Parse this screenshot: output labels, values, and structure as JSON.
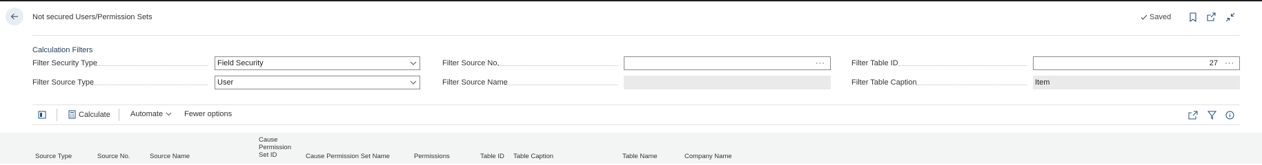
{
  "page": {
    "title": "Not secured Users/Permission Sets",
    "saved_label": "Saved"
  },
  "calculation_filters": {
    "section_title": "Calculation Filters",
    "filter_security_type": {
      "label": "Filter Security Type",
      "value": "Field Security"
    },
    "filter_source_type": {
      "label": "Filter Source Type",
      "value": "User"
    },
    "filter_source_no": {
      "label": "Filter Source No.",
      "value": ""
    },
    "filter_source_name": {
      "label": "Filter Source Name",
      "value": ""
    },
    "filter_table_id": {
      "label": "Filter Table ID",
      "value": "27"
    },
    "filter_table_caption": {
      "label": "Filter Table Caption",
      "value": "Item"
    },
    "ellipsis": "···"
  },
  "toolbar": {
    "calculate_label": "Calculate",
    "automate_label": "Automate",
    "fewer_options_label": "Fewer options"
  },
  "grid": {
    "columns": [
      "Source Type",
      "Source No.",
      "Source Name",
      "Cause Permission Set ID",
      "Cause Permission Set Name",
      "Permissions",
      "Table ID",
      "Table Caption",
      "Table Name",
      "Company Name"
    ],
    "cause_col_lines": [
      "Cause",
      "Permission",
      "Set ID"
    ]
  },
  "colors": {
    "accent": "#1f4f82",
    "field_border": "#8a8a8a",
    "readonly_bg": "#eaeaea",
    "grid_header_bg": "#f3f4f4"
  }
}
